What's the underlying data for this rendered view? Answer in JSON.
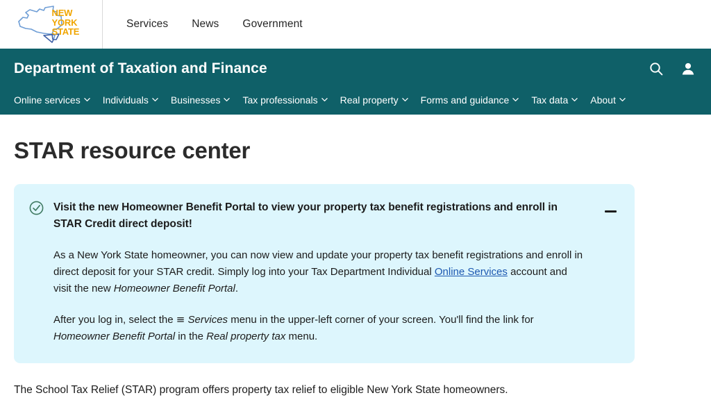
{
  "statebar": {
    "logo": {
      "line1": "NEW",
      "line2": "YORK",
      "line3": "STATE",
      "outline_color": "#4a72b8",
      "word_color": "#f0a500"
    },
    "links": [
      {
        "label": "Services"
      },
      {
        "label": "News"
      },
      {
        "label": "Government"
      }
    ]
  },
  "agency": {
    "title": "Department of Taxation and Finance",
    "bg_color": "#0f6068",
    "icons": [
      {
        "name": "search-icon",
        "label": "Search"
      },
      {
        "name": "account-icon",
        "label": "Account"
      }
    ],
    "nav": [
      {
        "label": "Online services",
        "has_chevron": true
      },
      {
        "label": "Individuals",
        "has_chevron": true
      },
      {
        "label": "Businesses",
        "has_chevron": true
      },
      {
        "label": "Tax professionals",
        "has_chevron": true
      },
      {
        "label": "Real property",
        "has_chevron": true
      },
      {
        "label": "Forms and guidance",
        "has_chevron": true
      },
      {
        "label": "Tax data",
        "has_chevron": true
      },
      {
        "label": "About",
        "has_chevron": true
      }
    ]
  },
  "main": {
    "page_title": "STAR resource center",
    "notice": {
      "bg_color": "#ddf6fd",
      "icon_color": "#3f7a62",
      "title": "Visit the new Homeowner Benefit Portal to view your property tax benefit registrations and enroll in STAR Credit direct deposit!",
      "collapse_label": "−",
      "paragraph1": {
        "part1": "As a New York State homeowner, you can now view and update your property tax benefit registrations and enroll in direct deposit for your STAR credit. Simply log into your Tax Department Individual ",
        "link_text": "Online Services",
        "part2": " account and visit the new ",
        "italic1": "Homeowner Benefit Portal",
        "part3": "."
      },
      "paragraph2": {
        "part1": "After you log in, select the ",
        "menu_glyph": "≡",
        "italic1": "Services",
        "part2": " menu in the upper-left corner of your screen. You'll find the link for ",
        "italic2": "Homeowner Benefit Portal",
        "part3": " in the ",
        "italic3": "Real property tax",
        "part4": " menu."
      },
      "link_color": "#1b57b0"
    },
    "intro_text": "The School Tax Relief (STAR) program offers property tax relief to eligible New York State homeowners."
  }
}
